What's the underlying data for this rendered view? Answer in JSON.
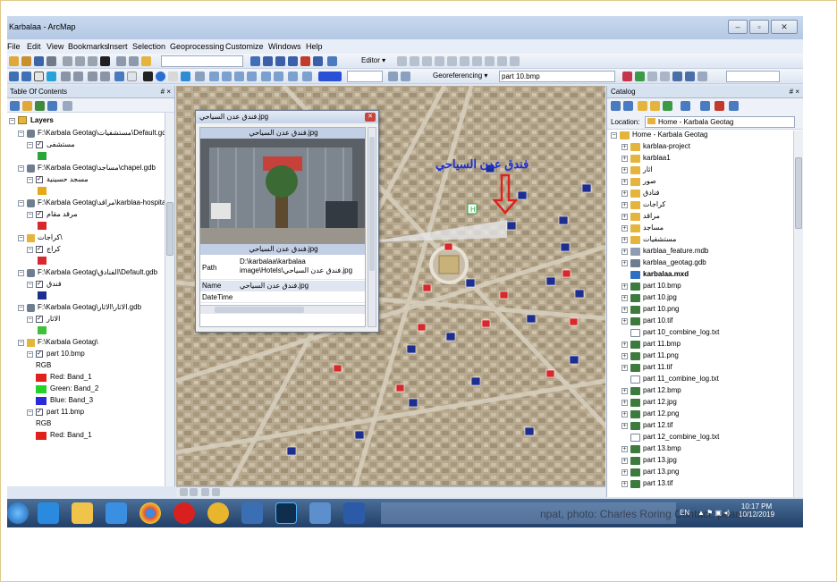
{
  "window": {
    "title": "Karbalaa - ArcMap",
    "controls": [
      "–",
      "▫",
      "✕"
    ]
  },
  "menu": [
    "File",
    "Edit",
    "View",
    "Bookmarks",
    "Insert",
    "Selection",
    "Geoprocessing",
    "Customize",
    "Windows",
    "Help"
  ],
  "toolbar": {
    "editor_label": "Editor ▾",
    "georef_label": "Georeferencing ▾",
    "georef_layer": "part 10.bmp"
  },
  "toc": {
    "title": "Table Of Contents",
    "pin": "# ×",
    "layers_label": "Layers",
    "rows": [
      {
        "text": "F:\\Karbala Geotag\\مستشفيات\\Default.gdb",
        "indent": 1,
        "kind": "gdb"
      },
      {
        "text": "مستشفى",
        "indent": 2,
        "kind": "layer"
      },
      {
        "text": "F:\\Karbala Geotag\\مساجد\\chapel.gdb",
        "indent": 1,
        "kind": "gdb"
      },
      {
        "text": "مسجد حسينية",
        "indent": 2,
        "kind": "layer"
      },
      {
        "text": "F:\\Karbala Geotag\\مراقد\\karblaa-hospital.gdb",
        "indent": 1,
        "kind": "gdb"
      },
      {
        "text": "مرقد مقام",
        "indent": 2,
        "kind": "layer"
      },
      {
        "text": "كراجات\\",
        "indent": 1,
        "kind": "folder"
      },
      {
        "text": "كراج",
        "indent": 2,
        "kind": "layer"
      },
      {
        "text": "F:\\Karbala Geotag\\الفنادق\\Default.gdb",
        "indent": 1,
        "kind": "gdb"
      },
      {
        "text": "فندق",
        "indent": 2,
        "kind": "layer"
      },
      {
        "text": "F:\\Karbala Geotag\\الاثار\\الاثار.gdb",
        "indent": 1,
        "kind": "gdb"
      },
      {
        "text": "الاثار",
        "indent": 2,
        "kind": "layer"
      },
      {
        "text": "F:\\Karbala Geotag\\",
        "indent": 1,
        "kind": "folder"
      },
      {
        "text": "part 10.bmp",
        "indent": 2,
        "kind": "raster"
      },
      {
        "text": "RGB",
        "indent": 3,
        "kind": "label"
      },
      {
        "text": "Red:   Band_1",
        "indent": 3,
        "kind": "band",
        "color": "#e0201c"
      },
      {
        "text": "Green: Band_2",
        "indent": 3,
        "kind": "band",
        "color": "#22d32a"
      },
      {
        "text": "Blue:  Band_3",
        "indent": 3,
        "kind": "band",
        "color": "#2a2bd8"
      },
      {
        "text": "part 11.bmp",
        "indent": 2,
        "kind": "raster"
      },
      {
        "text": "RGB",
        "indent": 3,
        "kind": "label"
      },
      {
        "text": "Red:   Band_1",
        "indent": 3,
        "kind": "band",
        "color": "#e0201c"
      }
    ]
  },
  "map": {
    "hotel_label": "فندق عدن السياحي"
  },
  "popup": {
    "title": "فندق عدن السياحي.jpg",
    "image_caption_top": "فندق عدن السياحي.jpg",
    "image_caption_bottom": "فندق عدن السياحي.jpg",
    "fields": [
      {
        "name": "Path",
        "value": "D:\\karbalaa\\karbalaa image\\Hotels\\فندق عدن السياحي.jpg"
      },
      {
        "name": "Name",
        "value": "فندق عدن السياحي.jpg"
      },
      {
        "name": "DateTime",
        "value": ""
      }
    ]
  },
  "catalog": {
    "title": "Catalog",
    "pin": "# ×",
    "location_label": "Location:",
    "location_value": "Home - Karbala Geotag",
    "items": [
      {
        "text": "Home - Karbala Geotag",
        "kind": "home",
        "indent": 0
      },
      {
        "text": "karblaa-project",
        "kind": "folder",
        "indent": 1
      },
      {
        "text": "karblaa1",
        "kind": "folder",
        "indent": 1
      },
      {
        "text": "اثار",
        "kind": "folder",
        "indent": 1
      },
      {
        "text": "صور",
        "kind": "folder",
        "indent": 1
      },
      {
        "text": "فنادق",
        "kind": "folder",
        "indent": 1
      },
      {
        "text": "كراجات",
        "kind": "folder",
        "indent": 1
      },
      {
        "text": "مراقد",
        "kind": "folder",
        "indent": 1
      },
      {
        "text": "مساجد",
        "kind": "folder",
        "indent": 1
      },
      {
        "text": "مستشفيات",
        "kind": "folder",
        "indent": 1
      },
      {
        "text": "karblaa_feature.mdb",
        "kind": "mdb",
        "indent": 1
      },
      {
        "text": "karblaa_geotag.gdb",
        "kind": "gdb",
        "indent": 1
      },
      {
        "text": "karbalaa.mxd",
        "kind": "mxd",
        "indent": 1
      },
      {
        "text": "part 10.bmp",
        "kind": "raster",
        "indent": 1
      },
      {
        "text": "part 10.jpg",
        "kind": "raster",
        "indent": 1
      },
      {
        "text": "part 10.png",
        "kind": "raster",
        "indent": 1
      },
      {
        "text": "part 10.tif",
        "kind": "raster",
        "indent": 1
      },
      {
        "text": "part 10_combine_log.txt",
        "kind": "txt",
        "indent": 1
      },
      {
        "text": "part 11.bmp",
        "kind": "raster",
        "indent": 1
      },
      {
        "text": "part 11.png",
        "kind": "raster",
        "indent": 1
      },
      {
        "text": "part 11.tif",
        "kind": "raster",
        "indent": 1
      },
      {
        "text": "part 11_combine_log.txt",
        "kind": "txt",
        "indent": 1
      },
      {
        "text": "part 12.bmp",
        "kind": "raster",
        "indent": 1
      },
      {
        "text": "part 12.jpg",
        "kind": "raster",
        "indent": 1
      },
      {
        "text": "part 12.png",
        "kind": "raster",
        "indent": 1
      },
      {
        "text": "part 12.tif",
        "kind": "raster",
        "indent": 1
      },
      {
        "text": "part 12_combine_log.txt",
        "kind": "txt",
        "indent": 1
      },
      {
        "text": "part 13.bmp",
        "kind": "raster",
        "indent": 1
      },
      {
        "text": "part 13.jpg",
        "kind": "raster",
        "indent": 1
      },
      {
        "text": "part 13.png",
        "kind": "raster",
        "indent": 1
      },
      {
        "text": "part 13.tif",
        "kind": "raster",
        "indent": 1
      }
    ]
  },
  "taskbar": {
    "apps": [
      "start-orb",
      "internet-explorer",
      "file-explorer",
      "media-center",
      "chrome",
      "opera",
      "paint-app",
      "arcgis-app",
      "photoshop",
      "network-app",
      "word"
    ],
    "overlay_text": "npat, photo: Charles Roring Contact: peace",
    "lang": "EN",
    "time": "10:17 PM",
    "date": "10/12/2019"
  },
  "colors": {
    "accent": "#2b5a96",
    "hotel_label": "#1b2fd6",
    "arrow": "#e0201c"
  }
}
